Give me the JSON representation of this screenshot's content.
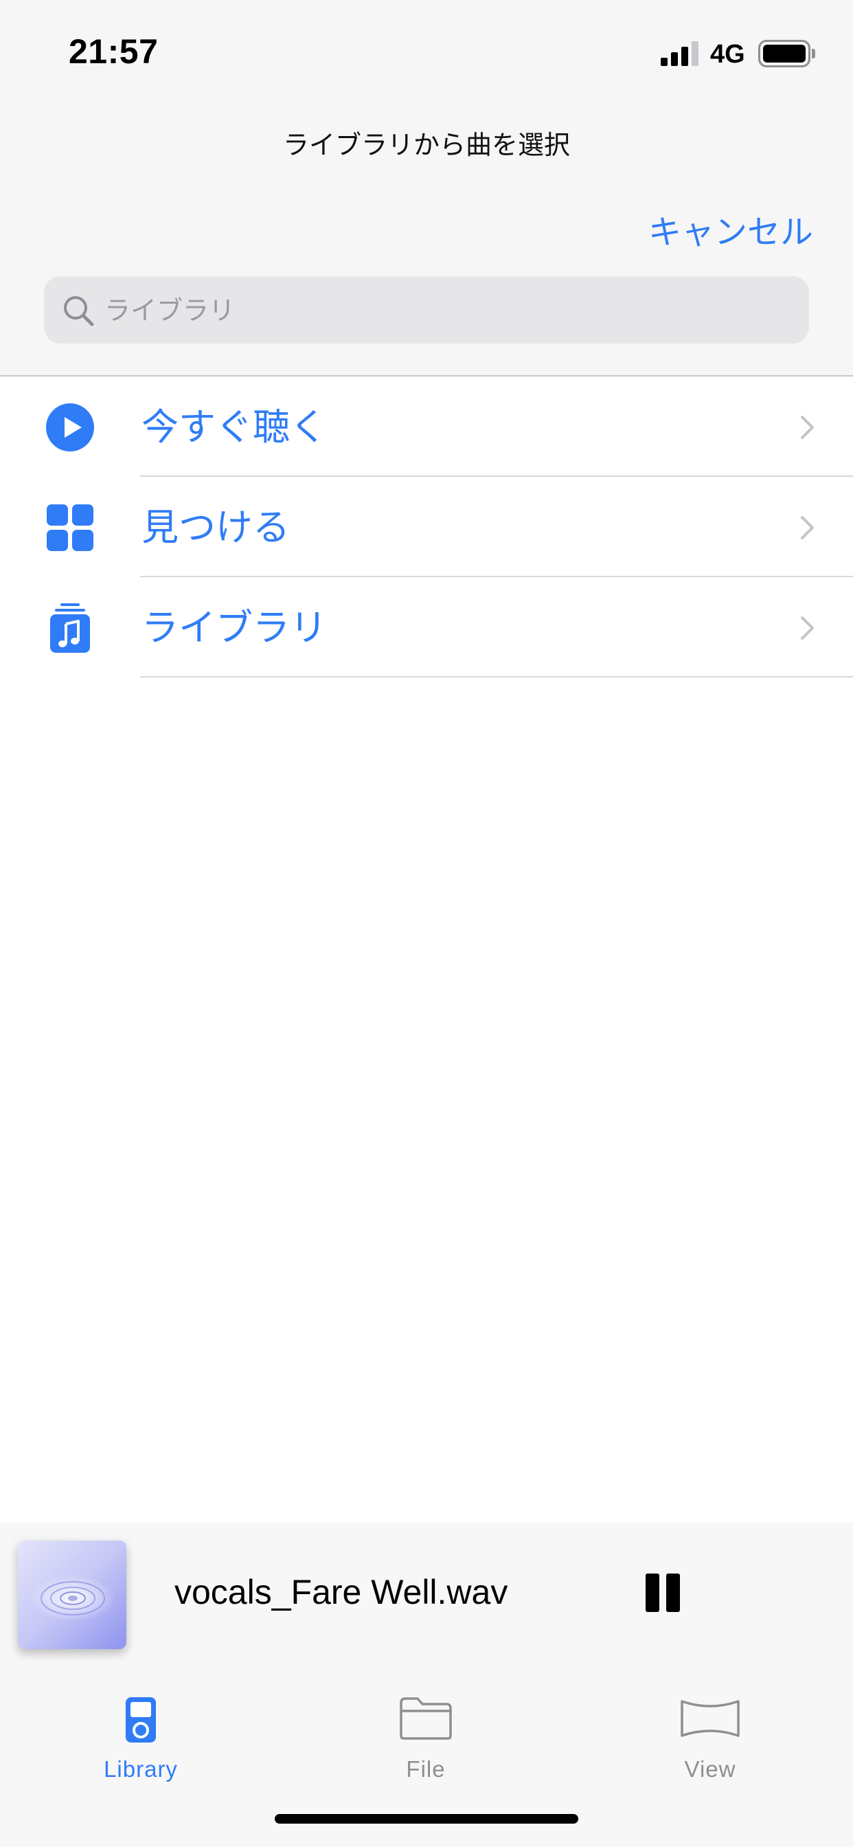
{
  "status_bar": {
    "time": "21:57",
    "network": "4G",
    "signal_bars_filled": 3,
    "signal_bars_total": 4,
    "battery_icon": "battery-full-icon"
  },
  "header": {
    "title": "ライブラリから曲を選択",
    "cancel_label": "キャンセル"
  },
  "search": {
    "placeholder": "ライブラリ",
    "value": "",
    "icon": "search-icon"
  },
  "menu": {
    "items": [
      {
        "label": "今すぐ聴く",
        "icon": "play-circle-icon"
      },
      {
        "label": "見つける",
        "icon": "grid-icon"
      },
      {
        "label": "ライブラリ",
        "icon": "music-library-icon"
      }
    ]
  },
  "now_playing": {
    "title": "vocals_Fare Well.wav",
    "control_icon": "pause-icon"
  },
  "tabs": [
    {
      "label": "Library",
      "icon": "ipod-icon",
      "selected": true
    },
    {
      "label": "File",
      "icon": "folder-icon",
      "selected": false
    },
    {
      "label": "View",
      "icon": "panorama-icon",
      "selected": false
    }
  ],
  "colors": {
    "accent": "#2f7cf6",
    "tab_inactive": "#8e8e93",
    "header_background": "#f6f6f6",
    "search_background": "#e6e6e8"
  }
}
